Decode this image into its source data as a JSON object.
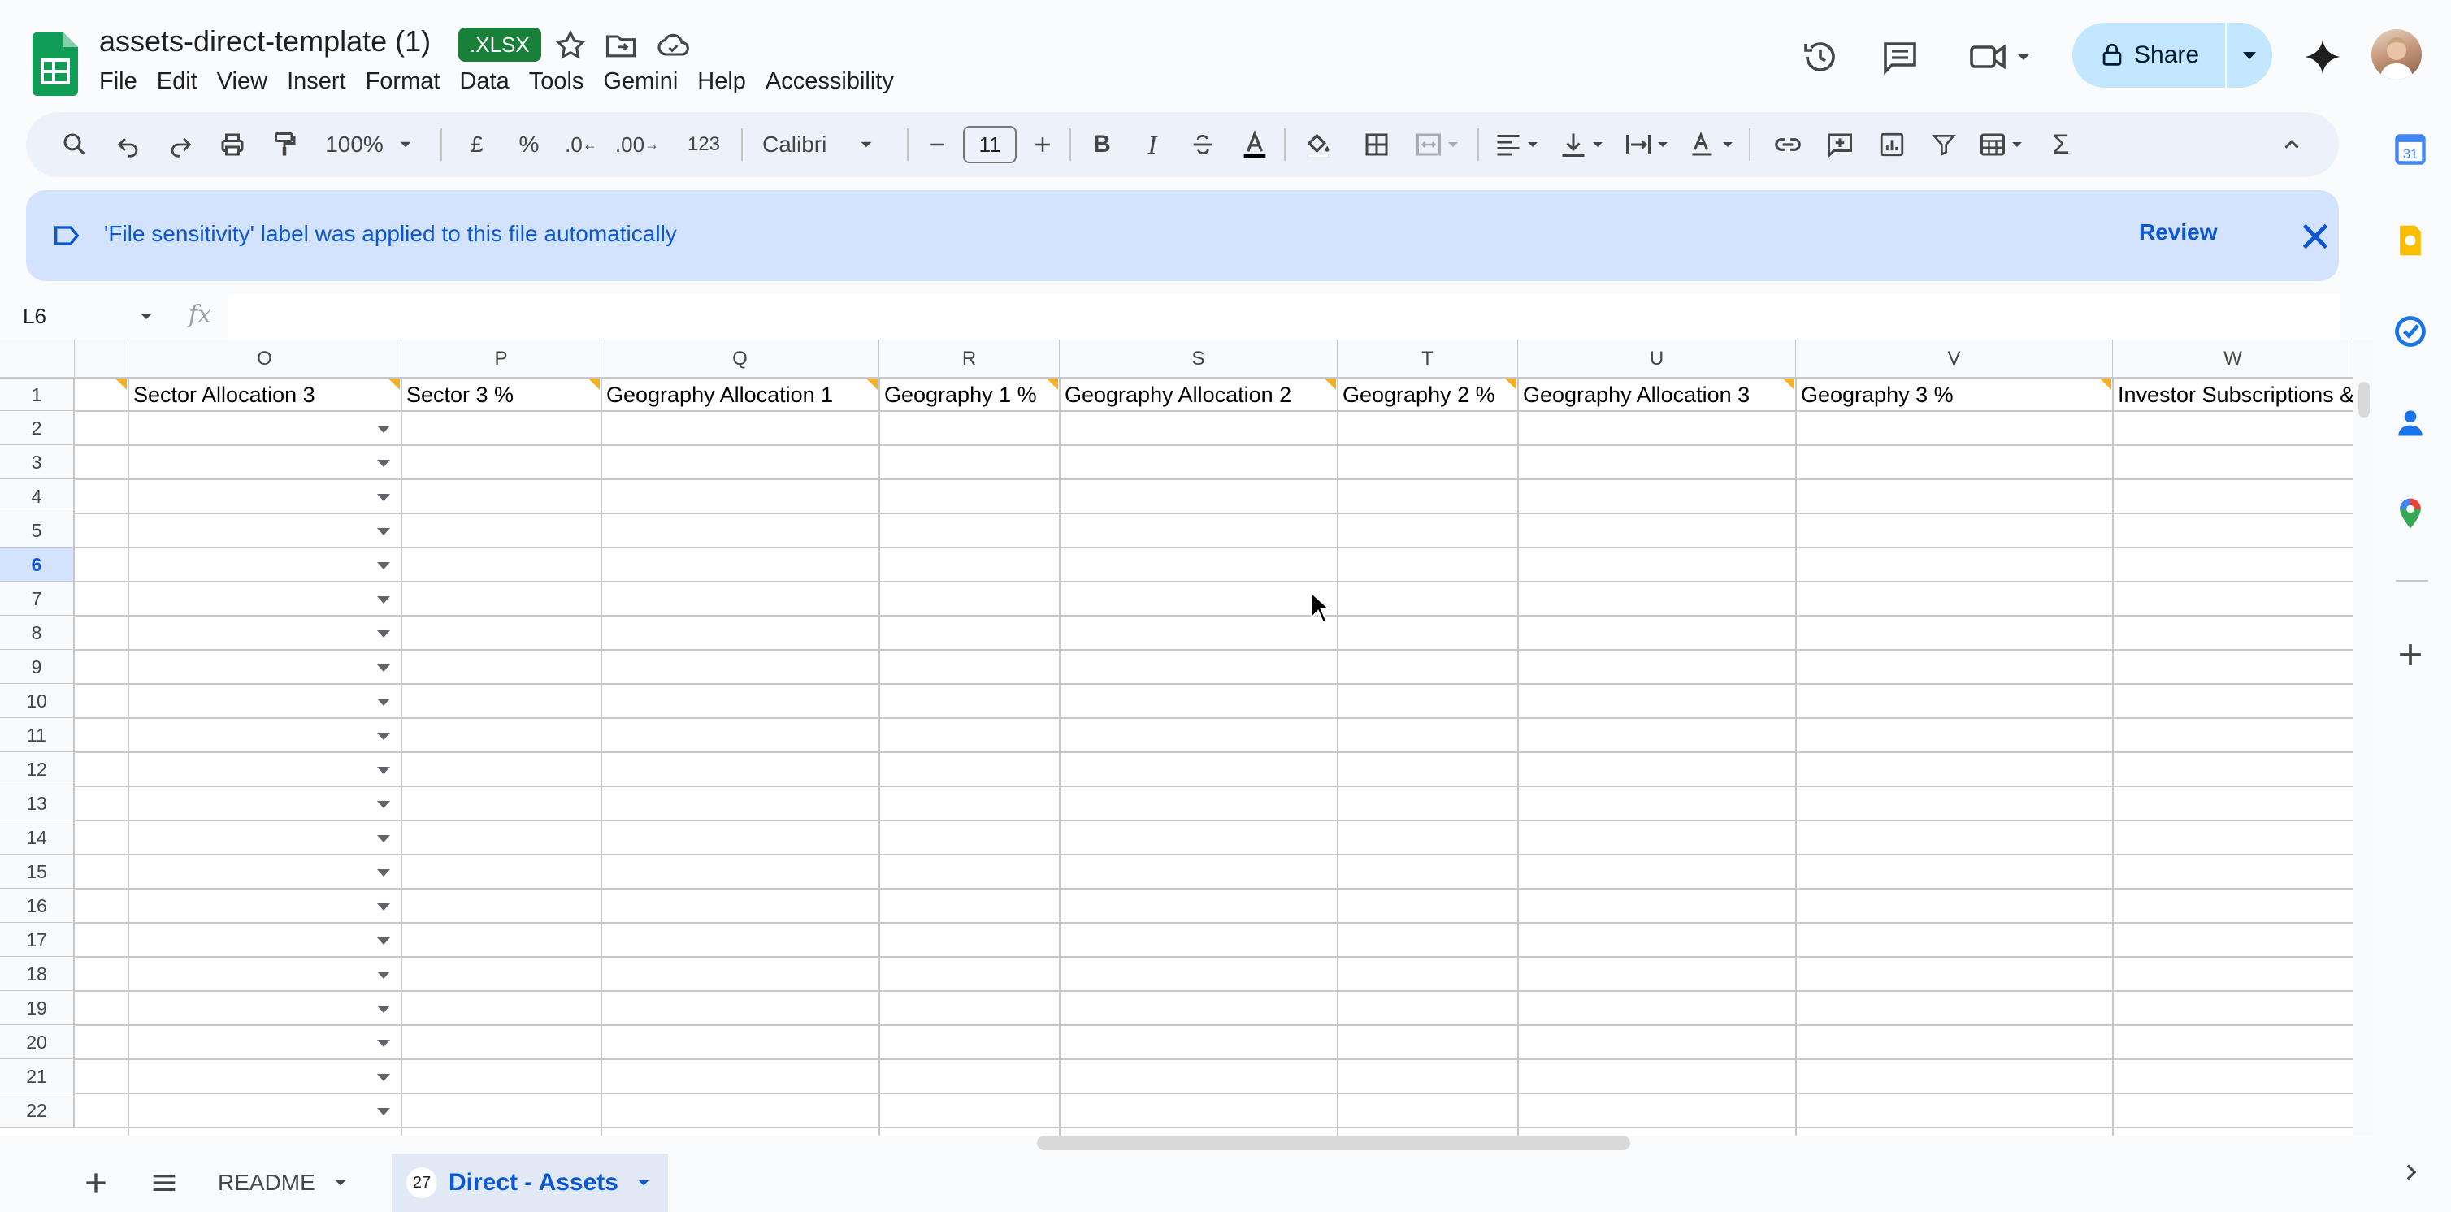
{
  "doc": {
    "title": "assets-direct-template (1)",
    "badge": ".XLSX"
  },
  "menu": [
    "File",
    "Edit",
    "View",
    "Insert",
    "Format",
    "Data",
    "Tools",
    "Gemini",
    "Help",
    "Accessibility"
  ],
  "share": {
    "label": "Share"
  },
  "toolbar": {
    "zoom": "100%",
    "currency": "£",
    "percent": "%",
    "decimal_decrease": ".0",
    "decimal_increase": ".00",
    "number_format": "123",
    "font": "Calibri",
    "font_size": "11"
  },
  "banner": {
    "text": "'File sensitivity' label was applied to this file automatically",
    "review": "Review"
  },
  "formula_bar": {
    "name_box": "L6",
    "fx": "fx"
  },
  "grid": {
    "columns": [
      "O",
      "P",
      "Q",
      "R",
      "S",
      "T",
      "U",
      "V",
      "W"
    ],
    "header_row": [
      "Sector Allocation 3",
      "Sector 3 %",
      "Geography Allocation 1",
      "Geography 1 %",
      "Geography Allocation 2",
      "Geography 2 %",
      "Geography Allocation 3",
      "Geography 3 %",
      "Investor Subscriptions &"
    ],
    "rows": [
      "1",
      "2",
      "3",
      "4",
      "5",
      "6",
      "7",
      "8",
      "9",
      "10",
      "11",
      "12",
      "13",
      "14",
      "15",
      "16",
      "17",
      "18",
      "19",
      "20",
      "21",
      "22"
    ],
    "selected_row": "6"
  },
  "sheets": {
    "tabs": [
      {
        "label": "README"
      },
      {
        "label": "Direct - Assets",
        "count": "27",
        "active": true
      }
    ]
  },
  "colors": {
    "accent": "#0b57d0",
    "banner_bg": "#d3e3fd",
    "share_bg": "#c2e7ff",
    "badge": "#188038"
  },
  "icons": [
    "sheets-logo-icon",
    "star-icon",
    "move-folder-icon",
    "cloud-status-icon",
    "history-icon",
    "comments-icon",
    "meet-icon",
    "lock-icon",
    "gemini-sparkle-icon",
    "search-menus-icon",
    "undo-icon",
    "redo-icon",
    "print-icon",
    "paint-format-icon",
    "bold-icon",
    "italic-icon",
    "strikethrough-icon",
    "text-color-icon",
    "fill-color-icon",
    "borders-icon",
    "merge-cells-icon",
    "align-icon",
    "valign-icon",
    "wrap-icon",
    "rotate-icon",
    "link-icon",
    "comment-add-icon",
    "chart-icon",
    "filter-icon",
    "table-icon",
    "functions-icon",
    "collapse-icon",
    "label-icon",
    "close-icon",
    "calendar-icon",
    "keep-icon",
    "tasks-icon",
    "contacts-icon",
    "maps-icon",
    "add-icon"
  ]
}
